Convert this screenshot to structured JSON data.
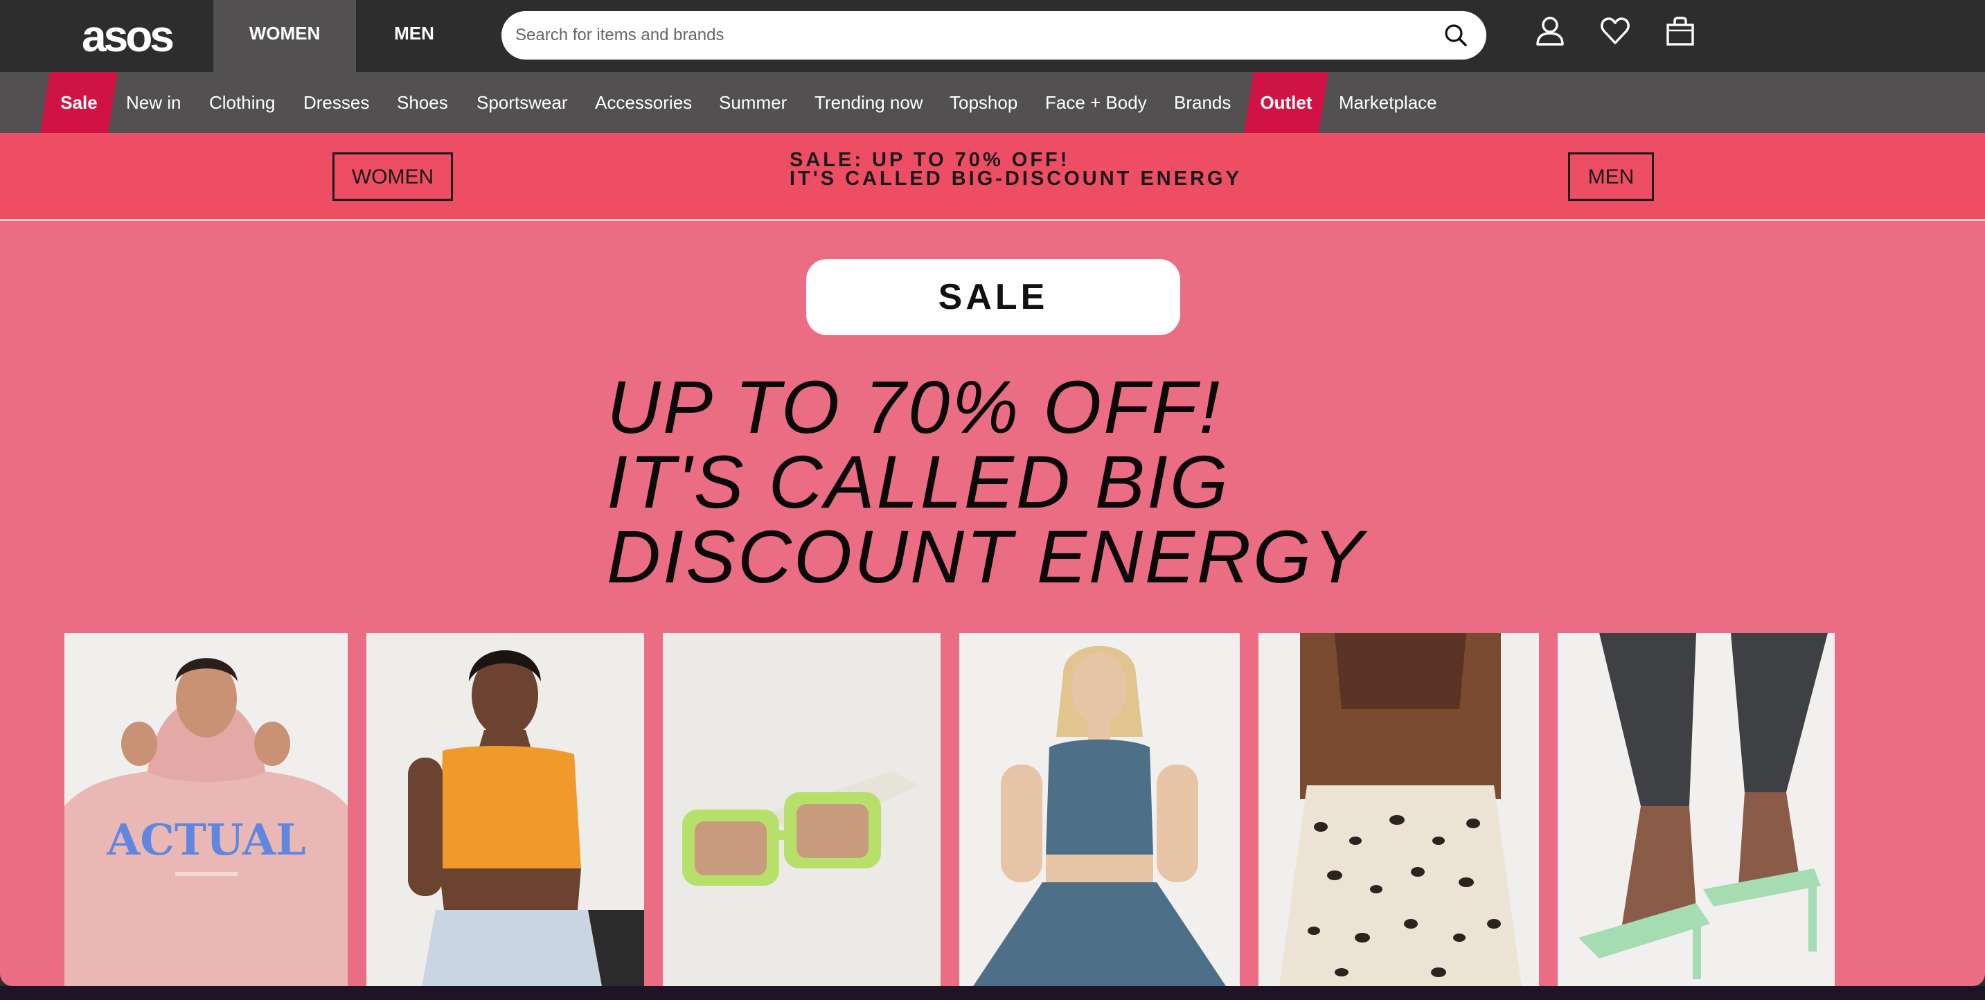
{
  "header": {
    "logo": "asos",
    "gender_tabs": [
      "WOMEN",
      "MEN"
    ],
    "search": {
      "placeholder": "Search for items and brands",
      "value": ""
    },
    "icons": [
      "search-icon",
      "account-icon",
      "heart-icon",
      "bag-icon"
    ]
  },
  "nav": {
    "items": [
      "Sale",
      "New in",
      "Clothing",
      "Dresses",
      "Shoes",
      "Sportswear",
      "Accessories",
      "Summer",
      "Trending now",
      "Topshop",
      "Face + Body",
      "Brands",
      "Outlet",
      "Marketplace"
    ],
    "highlighted": [
      "Sale",
      "Outlet"
    ]
  },
  "promo": {
    "women_button": "WOMEN",
    "men_button": "MEN",
    "line1": "SALE: UP TO 70% OFF!",
    "line2": "IT'S CALLED BIG-DISCOUNT ENERGY"
  },
  "hero": {
    "sale_button": "SALE",
    "headline": [
      "UP TO 70% OFF!",
      "IT'S CALLED BIG",
      "DISCOUNT ENERGY"
    ]
  },
  "products": [
    {
      "name": "pink-hoodie-product",
      "print": "ACTUAL"
    },
    {
      "name": "orange-crop-top-product"
    },
    {
      "name": "green-sunglasses-product"
    },
    {
      "name": "blue-activewear-product"
    },
    {
      "name": "leopard-shorts-product"
    },
    {
      "name": "mint-heeled-sandals-product"
    }
  ],
  "colors": {
    "header_bg": "#2d2d2d",
    "nav_bg": "#525050",
    "sale_highlight": "#d01345",
    "promo_bg": "#ee4e63",
    "hero_bg": "#eb6d83"
  }
}
